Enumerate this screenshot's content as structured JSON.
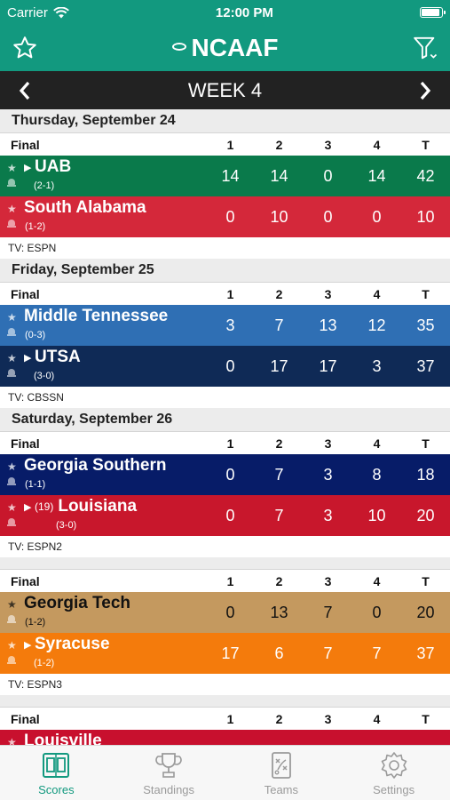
{
  "status": {
    "carrier": "Carrier",
    "time": "12:00 PM",
    "battery_level": 1.0
  },
  "nav": {
    "title": "NCAAF"
  },
  "week": {
    "title": "WEEK 4"
  },
  "quarters": [
    "1",
    "2",
    "3",
    "4",
    "T"
  ],
  "final_label": "Final",
  "games": [
    {
      "day": "Thursday, September 24",
      "status": "Final",
      "tv": "TV: ESPN",
      "teams": [
        {
          "name": "UAB",
          "record": "(2-1)",
          "rank": "",
          "has_possession_arrow": true,
          "color": "#0a7a4b",
          "scores": [
            "14",
            "14",
            "0",
            "14",
            "42"
          ]
        },
        {
          "name": "South Alabama",
          "record": "(1-2)",
          "rank": "",
          "has_possession_arrow": false,
          "color": "#d4283a",
          "scores": [
            "0",
            "10",
            "0",
            "0",
            "10"
          ]
        }
      ]
    },
    {
      "day": "Friday, September 25",
      "status": "Final",
      "tv": "TV: CBSSN",
      "teams": [
        {
          "name": "Middle Tennessee",
          "record": "(0-3)",
          "rank": "",
          "has_possession_arrow": false,
          "color": "#2f6fb4",
          "scores": [
            "3",
            "7",
            "13",
            "12",
            "35"
          ]
        },
        {
          "name": "UTSA",
          "record": "(3-0)",
          "rank": "",
          "has_possession_arrow": true,
          "color": "#0f2a56",
          "scores": [
            "0",
            "17",
            "17",
            "3",
            "37"
          ]
        }
      ]
    },
    {
      "day": "Saturday, September 26",
      "status": "Final",
      "tv": "TV: ESPN2",
      "teams": [
        {
          "name": "Georgia Southern",
          "record": "(1-1)",
          "rank": "",
          "has_possession_arrow": false,
          "color": "#071c68",
          "scores": [
            "0",
            "7",
            "3",
            "8",
            "18"
          ]
        },
        {
          "name": "Louisiana",
          "record": "(3-0)",
          "rank": "(19)",
          "has_possession_arrow": true,
          "color": "#c8172c",
          "scores": [
            "0",
            "7",
            "3",
            "10",
            "20"
          ]
        }
      ]
    },
    {
      "day": "",
      "status": "Final",
      "tv": "TV: ESPN3",
      "teams": [
        {
          "name": "Georgia Tech",
          "record": "(1-2)",
          "rank": "",
          "has_possession_arrow": false,
          "color": "#c4995f",
          "text_color": "#111111",
          "scores": [
            "0",
            "13",
            "7",
            "0",
            "20"
          ]
        },
        {
          "name": "Syracuse",
          "record": "(1-2)",
          "rank": "",
          "has_possession_arrow": true,
          "color": "#f47b0c",
          "scores": [
            "17",
            "6",
            "7",
            "7",
            "37"
          ]
        }
      ]
    },
    {
      "day": "",
      "status": "Final",
      "tv": "",
      "teams": [
        {
          "name": "Louisville",
          "record": "",
          "rank": "",
          "has_possession_arrow": false,
          "color": "#c8102e",
          "scores": [
            "",
            "",
            "",
            "",
            ""
          ]
        }
      ]
    }
  ],
  "tabs": [
    {
      "label": "Scores",
      "icon": "scoreboard-icon",
      "active": true
    },
    {
      "label": "Standings",
      "icon": "trophy-icon",
      "active": false
    },
    {
      "label": "Teams",
      "icon": "playbook-icon",
      "active": false
    },
    {
      "label": "Settings",
      "icon": "gear-icon",
      "active": false
    }
  ],
  "colors": {
    "accent": "#12997f",
    "week_bar": "#222222"
  }
}
